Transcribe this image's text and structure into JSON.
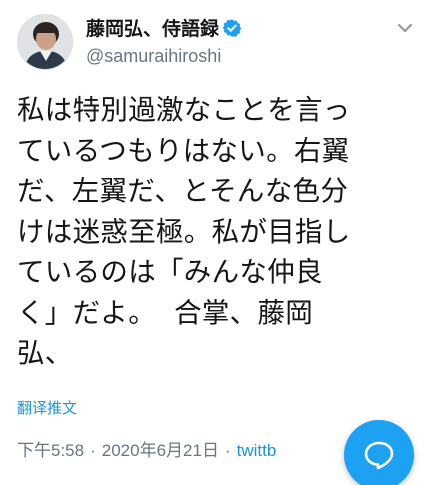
{
  "tweet": {
    "display_name": "藤岡弘、侍語録",
    "handle": "@samuraihiroshi",
    "text": "私は特別過激なことを言っ\nているつもりはない。右翼\nだ、左翼だ、とそんな色分\nけは迷惑至極。私が目指し\nているのは「みんな仲良\nく」だよ。  合掌、藤岡\n弘、",
    "translate_label": "翻译推文",
    "time": "下午5:58",
    "date": "2020年6月21日",
    "source": "twittb",
    "separator": "·"
  },
  "icons": {
    "verified": "verified-badge-icon",
    "chevron": "chevron-down-icon",
    "compose": "reply-bubble-icon"
  },
  "colors": {
    "accent": "#1da1f2",
    "link": "#1b95e0",
    "secondary_text": "#657786",
    "primary_text": "#14171a"
  }
}
